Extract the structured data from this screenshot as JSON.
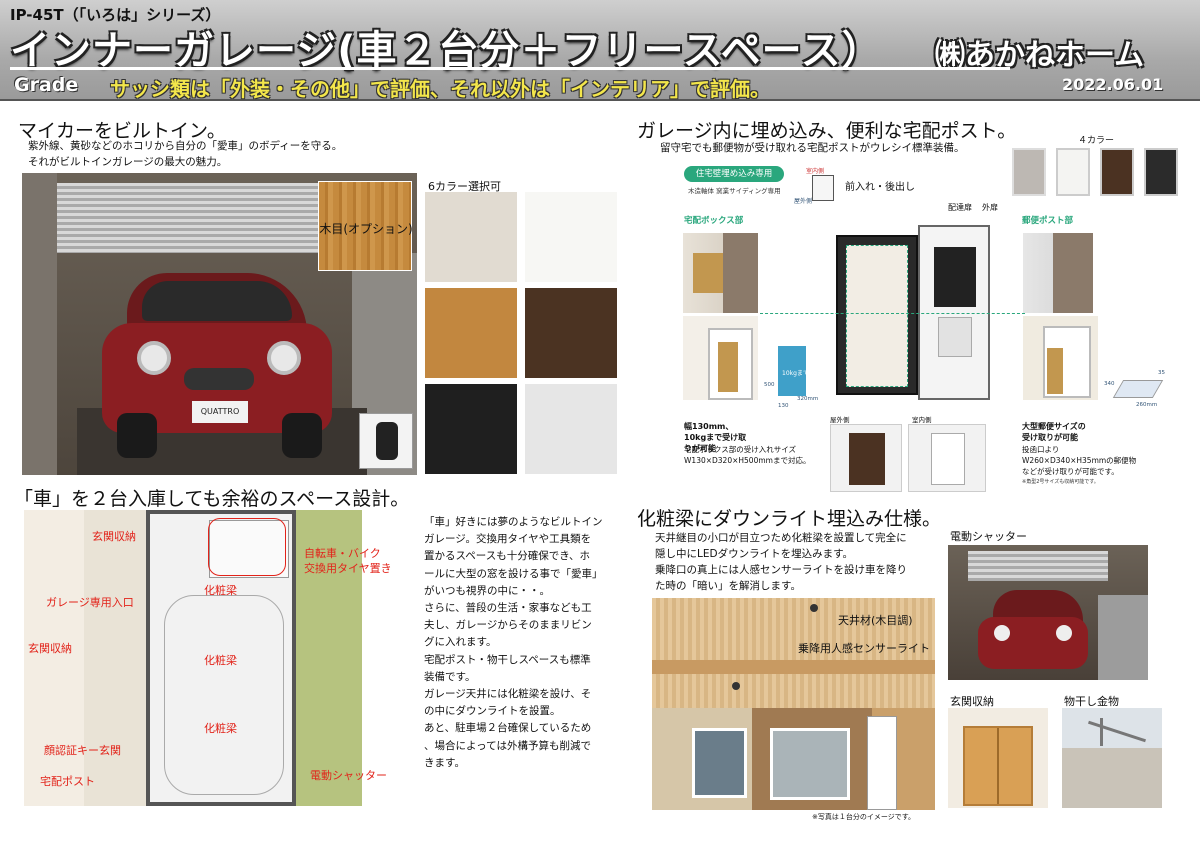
{
  "header": {
    "series": "IP-45T（「いろは」シリーズ）",
    "title": "インナーガレージ(車２台分＋フリースペース）",
    "company": "㈱あかねホーム",
    "grade_label": "Grade",
    "grade_text": "サッシ類は「外装・その他」で評価、それ以外は「インテリア」で評価。",
    "date": "2022.06.01"
  },
  "sec1": {
    "heading": "マイカーをビルトイン。",
    "line1": "紫外線、黄砂などのホコリから自分の「愛車」のボディーを守る。",
    "line2": "それがビルトインガレージの最大の魅力。",
    "wood_label": "木目(オプション)",
    "plate": "QUATTRO",
    "colors_heading": "6カラー選択可",
    "swatches": [
      "#e1dbd1",
      "#f7f7f4",
      "#c2873f",
      "#4b3322",
      "#1f1f1f",
      "#e6e6e6"
    ]
  },
  "sec2": {
    "heading": "ガレージ内に埋め込み、便利な宅配ポスト。",
    "intro": "留守宅でも郵便物が受け取れる宅配ポストがウレシイ標準装備。",
    "colors4": "４カラー",
    "badge": "住宅壁埋め込み専用",
    "sub": "木造軸体 窯業サイディング専用",
    "front_back": "前入れ・後出し",
    "room_in": "室内側",
    "outside_small": "屋外側",
    "delivery_box": "宅配ボックス部",
    "delivery_door": "配達扉",
    "outer_door": "外扉",
    "mail_post": "郵便ポスト部",
    "weight": "10kgまで",
    "capacity_title": "幅130mm、10kgまで受け取りが可能",
    "capacity_desc": "宅配ボックス部の受け入れサイズ W130×D320×H500mmまで対応。",
    "outside": "屋外側",
    "inside": "室内側",
    "mail_title": "大型郵便サイズの受け取りが可能",
    "mail_desc": "投函口より W260×D340×H35mmの郵便物などが受け取りが可能です。",
    "mail_note": "※角型2号サイズも収納可能です。",
    "dims": [
      "500",
      "320mm",
      "130",
      "340",
      "35",
      "260mm"
    ]
  },
  "sec3": {
    "heading": "「車」を２台入庫しても余裕のスペース設計。",
    "labels": {
      "entrance_storage_top": "玄関収納",
      "bike": "自転車・バイク",
      "tire": "交換用タイヤ置き",
      "beam1": "化粧梁",
      "garage_entry": "ガレージ専用入口",
      "entrance_storage": "玄関収納",
      "beam2": "化粧梁",
      "beam3": "化粧梁",
      "face_key": "顔認証キー玄関",
      "shutter": "電動シャッター",
      "post": "宅配ポスト"
    },
    "body": [
      "「車」好きには夢のようなビルトイン",
      "ガレージ。交換用タイヤや工具類を",
      "置かるスペースも十分確保でき、ホ",
      "ールに大型の窓を設ける事で「愛車」",
      "がいつも視界の中に・・。",
      "さらに、普段の生活・家事なども工",
      "夫し、ガレージからそのままリビン",
      "グに入れます。",
      "宅配ポスト・物干しスペースも標準",
      "装備です。",
      "ガレージ天井には化粧梁を設け、そ",
      "の中にダウンライトを設置。",
      "あと、駐車場２台確保しているため",
      "、場合によっては外構予算も削減で",
      "きます。"
    ]
  },
  "sec4": {
    "heading": "化粧梁にダウンライト埋込み仕様。",
    "line1": "天井継目の小口が目立つため化粧梁を設置して完全に",
    "line2": "隠し中にLEDダウンライトを埋込みます。",
    "line3": "乗降口の真上には人感センサーライトを設け車を降り",
    "line4": "た時の「暗い」を解消します。",
    "ceiling": "天井材(木目調)",
    "sensor": "乗降用人感センサーライト",
    "note": "※写真は１台分のイメージです。",
    "shutter": "電動シャッター",
    "storage": "玄関収納",
    "hanger": "物干し金物"
  }
}
